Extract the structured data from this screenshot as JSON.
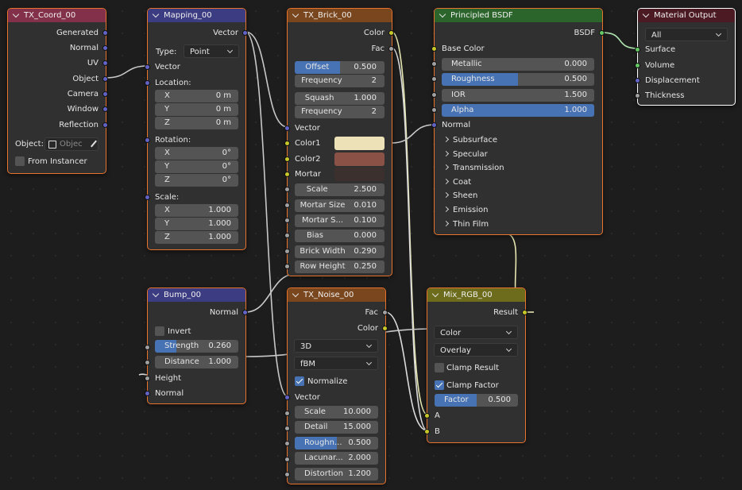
{
  "nodes": {
    "tex_coord": {
      "title": "TX_Coord_00",
      "outputs": [
        "Generated",
        "Normal",
        "UV",
        "Object",
        "Camera",
        "Window",
        "Reflection"
      ],
      "object_label": "Object:",
      "object_placeholder": "Objec",
      "from_instancer": "From Instancer"
    },
    "mapping": {
      "title": "Mapping_00",
      "output": "Vector",
      "type_label": "Type:",
      "type_value": "Point",
      "vector_in": "Vector",
      "location_label": "Location:",
      "location": [
        {
          "axis": "X",
          "value": "0 m"
        },
        {
          "axis": "Y",
          "value": "0 m"
        },
        {
          "axis": "Z",
          "value": "0 m"
        }
      ],
      "rotation_label": "Rotation:",
      "rotation": [
        {
          "axis": "X",
          "value": "0°"
        },
        {
          "axis": "Y",
          "value": "0°"
        },
        {
          "axis": "Z",
          "value": "0°"
        }
      ],
      "scale_label": "Scale:",
      "scale": [
        {
          "axis": "X",
          "value": "1.000"
        },
        {
          "axis": "Y",
          "value": "1.000"
        },
        {
          "axis": "Z",
          "value": "1.000"
        }
      ]
    },
    "brick": {
      "title": "TX_Brick_00",
      "out_color": "Color",
      "out_fac": "Fac",
      "offset": {
        "label": "Offset",
        "value": "0.500",
        "fraction": 0.5
      },
      "offset_freq": {
        "label": "Frequency",
        "value": "2"
      },
      "squash": {
        "label": "Squash",
        "value": "1.000"
      },
      "squash_freq": {
        "label": "Frequency",
        "value": "2"
      },
      "vector_in": "Vector",
      "color1": "Color1",
      "color2": "Color2",
      "mortar": "Mortar",
      "color1_hex": "#ede1b7",
      "color2_hex": "#8a5246",
      "mortar_hex": "#3b302e",
      "params": [
        {
          "label": "Scale",
          "value": "2.500"
        },
        {
          "label": "Mortar Size",
          "value": "0.010"
        },
        {
          "label": "Mortar S...",
          "value": "0.100"
        },
        {
          "label": "Bias",
          "value": "0.000"
        },
        {
          "label": "Brick Width",
          "value": "0.290"
        },
        {
          "label": "Row Height",
          "value": "0.250"
        }
      ]
    },
    "bsdf": {
      "title": "Principled BSDF",
      "output": "BSDF",
      "base_color": "Base Color",
      "metallic": {
        "label": "Metallic",
        "value": "0.000",
        "fraction": 0.0
      },
      "roughness": {
        "label": "Roughness",
        "value": "0.500",
        "fraction": 0.5
      },
      "ior": {
        "label": "IOR",
        "value": "1.500",
        "fraction": 0.0
      },
      "alpha": {
        "label": "Alpha",
        "value": "1.000",
        "fraction": 1.0
      },
      "normal": "Normal",
      "panels": [
        "Subsurface",
        "Specular",
        "Transmission",
        "Coat",
        "Sheen",
        "Emission",
        "Thin Film"
      ]
    },
    "output": {
      "title": "Material Output",
      "target": "All",
      "inputs": [
        "Surface",
        "Volume",
        "Displacement",
        "Thickness"
      ]
    },
    "bump": {
      "title": "Bump_00",
      "output": "Normal",
      "invert": "Invert",
      "strength": {
        "label": "Strength",
        "value": "0.260",
        "fraction": 0.26
      },
      "distance": {
        "label": "Distance",
        "value": "1.000"
      },
      "height": "Height",
      "normal_in": "Normal"
    },
    "noise": {
      "title": "TX_Noise_00",
      "out_fac": "Fac",
      "out_color": "Color",
      "dimensions": "3D",
      "type": "fBM",
      "normalize": "Normalize",
      "vector_in": "Vector",
      "params": [
        {
          "label": "Scale",
          "value": "10.000",
          "fraction": 0
        },
        {
          "label": "Detail",
          "value": "15.000",
          "fraction": 0
        },
        {
          "label": "Roughn...",
          "value": "0.500",
          "fraction": 0.5
        },
        {
          "label": "Lacunar...",
          "value": "2.000",
          "fraction": 0
        },
        {
          "label": "Distortion",
          "value": "1.200",
          "fraction": 0
        }
      ]
    },
    "mix": {
      "title": "Mix_RGB_00",
      "output": "Result",
      "data_type": "Color",
      "blend": "Overlay",
      "clamp_result": "Clamp Result",
      "clamp_factor": "Clamp Factor",
      "factor": {
        "label": "Factor",
        "value": "0.500",
        "fraction": 0.5
      },
      "a": "A",
      "b": "B"
    }
  },
  "colors": {
    "accent_selected": "#e8732d",
    "slider_fill": "#4772b3",
    "socket_vector": "#6363c7",
    "socket_color": "#c7c729",
    "socket_float": "#a1a1a1",
    "socket_shader": "#63c763"
  }
}
